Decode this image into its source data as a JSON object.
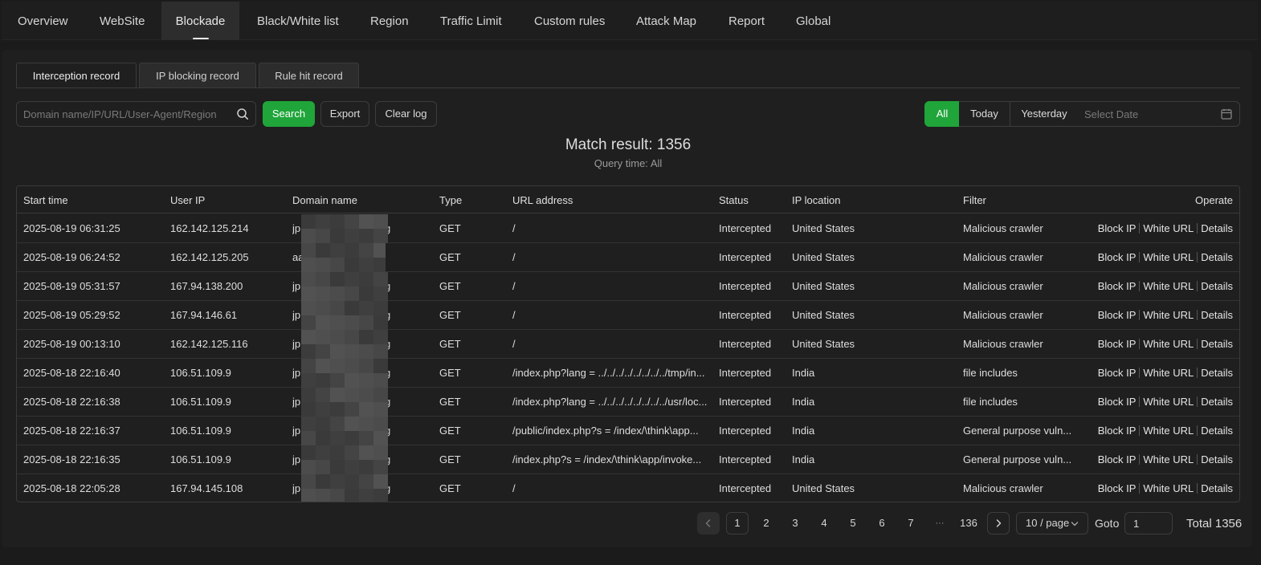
{
  "topnav": {
    "tabs": [
      {
        "label": "Overview"
      },
      {
        "label": "WebSite"
      },
      {
        "label": "Blockade"
      },
      {
        "label": "Black/White list"
      },
      {
        "label": "Region"
      },
      {
        "label": "Traffic Limit"
      },
      {
        "label": "Custom rules"
      },
      {
        "label": "Attack Map"
      },
      {
        "label": "Report"
      },
      {
        "label": "Global"
      }
    ],
    "active": "Blockade"
  },
  "subtabs": {
    "items": [
      {
        "label": "Interception record"
      },
      {
        "label": "IP blocking record"
      },
      {
        "label": "Rule hit record"
      }
    ],
    "active": "Interception record"
  },
  "toolbar": {
    "search_placeholder": "Domain name/IP/URL/User-Agent/Region",
    "search_value": "",
    "search_label": "Search",
    "export_label": "Export",
    "clear_label": "Clear log",
    "date_filters": [
      "All",
      "Today",
      "Yesterday"
    ],
    "date_active": "All",
    "date_placeholder": "Select Date"
  },
  "summary": {
    "match_result": "Match result: 1356",
    "query_time": "Query time: All"
  },
  "table": {
    "columns": [
      "Start time",
      "User IP",
      "Domain name",
      "Type",
      "URL address",
      "Status",
      "IP location",
      "Filter",
      "Operate"
    ],
    "rows": [
      {
        "start_time": "2025-08-19 06:31:25",
        "user_ip": "162.142.125.214",
        "domain_prefix": "jp",
        "domain_suffix": "g",
        "type": "GET",
        "url": "/",
        "status": "Intercepted",
        "location": "United States",
        "filter": "Malicious crawler"
      },
      {
        "start_time": "2025-08-19 06:24:52",
        "user_ip": "162.142.125.205",
        "domain_prefix": "aa",
        "domain_suffix": "",
        "type": "GET",
        "url": "/",
        "status": "Intercepted",
        "location": "United States",
        "filter": "Malicious crawler"
      },
      {
        "start_time": "2025-08-19 05:31:57",
        "user_ip": "167.94.138.200",
        "domain_prefix": "jp",
        "domain_suffix": "g",
        "type": "GET",
        "url": "/",
        "status": "Intercepted",
        "location": "United States",
        "filter": "Malicious crawler"
      },
      {
        "start_time": "2025-08-19 05:29:52",
        "user_ip": "167.94.146.61",
        "domain_prefix": "jp",
        "domain_suffix": "g",
        "type": "GET",
        "url": "/",
        "status": "Intercepted",
        "location": "United States",
        "filter": "Malicious crawler"
      },
      {
        "start_time": "2025-08-19 00:13:10",
        "user_ip": "162.142.125.116",
        "domain_prefix": "jp",
        "domain_suffix": "g",
        "type": "GET",
        "url": "/",
        "status": "Intercepted",
        "location": "United States",
        "filter": "Malicious crawler"
      },
      {
        "start_time": "2025-08-18 22:16:40",
        "user_ip": "106.51.109.9",
        "domain_prefix": "jp",
        "domain_suffix": "g",
        "type": "GET",
        "url": "/index.php?lang = ../../../../../../../../tmp/in...",
        "status": "Intercepted",
        "location": "India",
        "filter": "file includes"
      },
      {
        "start_time": "2025-08-18 22:16:38",
        "user_ip": "106.51.109.9",
        "domain_prefix": "jp",
        "domain_suffix": "g",
        "type": "GET",
        "url": "/index.php?lang = ../../../../../../../../usr/loc...",
        "status": "Intercepted",
        "location": "India",
        "filter": "file includes"
      },
      {
        "start_time": "2025-08-18 22:16:37",
        "user_ip": "106.51.109.9",
        "domain_prefix": "jp",
        "domain_suffix": "g",
        "type": "GET",
        "url": "/public/index.php?s = /index/\\think\\app...",
        "status": "Intercepted",
        "location": "India",
        "filter": "General purpose vuln..."
      },
      {
        "start_time": "2025-08-18 22:16:35",
        "user_ip": "106.51.109.9",
        "domain_prefix": "jp",
        "domain_suffix": "g",
        "type": "GET",
        "url": "/index.php?s = /index/\\think\\app/invoke...",
        "status": "Intercepted",
        "location": "India",
        "filter": "General purpose vuln..."
      },
      {
        "start_time": "2025-08-18 22:05:28",
        "user_ip": "167.94.145.108",
        "domain_prefix": "jp",
        "domain_suffix": "g",
        "type": "GET",
        "url": "/",
        "status": "Intercepted",
        "location": "United States",
        "filter": "Malicious crawler"
      }
    ],
    "actions": [
      "Block IP",
      "White URL",
      "Details"
    ]
  },
  "pagination": {
    "pages": [
      "1",
      "2",
      "3",
      "4",
      "5",
      "6",
      "7",
      "···",
      "136"
    ],
    "current": "1",
    "page_size": "10 / page",
    "goto_label": "Goto",
    "goto_value": "1",
    "total": "Total 1356"
  },
  "colors": {
    "accent": "#20a53a",
    "background": "#1b1b1b",
    "panel": "#1f1f1f",
    "border": "#3a3a3a"
  },
  "icons": [
    "search-icon",
    "calendar-icon",
    "chevron-left-icon",
    "chevron-right-icon",
    "chevron-down-icon"
  ]
}
